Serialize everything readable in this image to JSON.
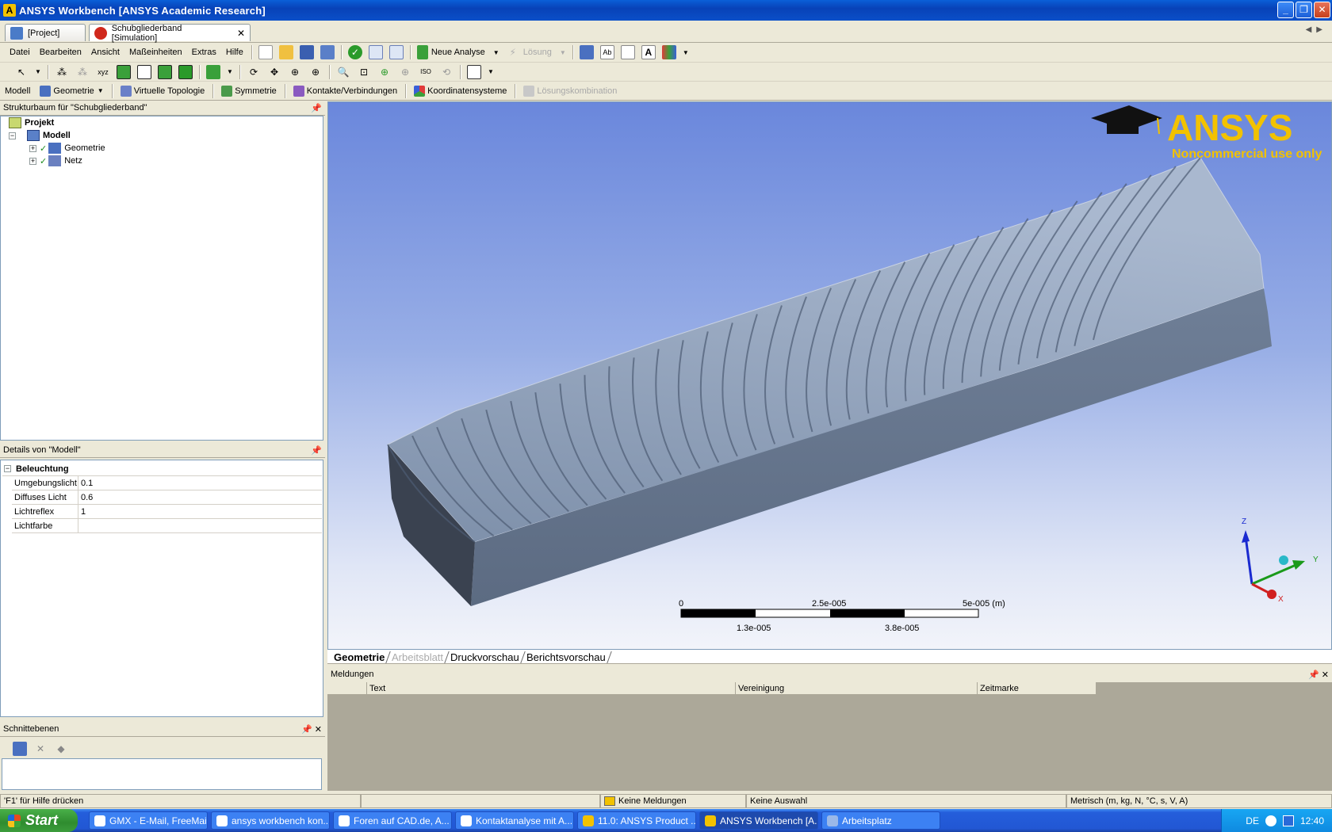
{
  "window": {
    "title": "ANSYS Workbench [ANSYS Academic Research]",
    "app_icon": "ansys-icon"
  },
  "doc_tabs": [
    {
      "label": "[Project]",
      "icon": "project-icon"
    },
    {
      "label": "Schubgliederband [Simulation]",
      "icon": "simulation-icon",
      "close": "✕"
    }
  ],
  "menu": [
    "Datei",
    "Bearbeiten",
    "Ansicht",
    "Maßeinheiten",
    "Extras",
    "Hilfe"
  ],
  "toolbar": {
    "new_analysis": "Neue Analyse",
    "solve": "Lösung"
  },
  "context_bar": {
    "model": "Modell",
    "geometry": "Geometrie",
    "virtual_topology": "Virtuelle Topologie",
    "symmetry": "Symmetrie",
    "contacts": "Kontakte/Verbindungen",
    "coordinate_systems": "Koordinatensysteme",
    "solution_combination": "Lösungskombination"
  },
  "tree_panel": {
    "title": "Strukturbaum für \"Schubgliederband\"",
    "items": [
      {
        "label": "Projekt",
        "level": 0
      },
      {
        "label": "Modell",
        "level": 1
      },
      {
        "label": "Geometrie",
        "level": 2
      },
      {
        "label": "Netz",
        "level": 2
      }
    ]
  },
  "details_panel": {
    "title": "Details von \"Modell\"",
    "section": "Beleuchtung",
    "rows": [
      {
        "key": "Umgebungslicht",
        "value": "0.1"
      },
      {
        "key": "Diffuses Licht",
        "value": "0.6"
      },
      {
        "key": "Lichtreflex",
        "value": "1"
      },
      {
        "key": "Lichtfarbe",
        "value": ""
      }
    ]
  },
  "cut_panel": {
    "title": "Schnittebenen"
  },
  "viewport": {
    "logo_text": "ANSYS",
    "watermark": "Noncommercial use only",
    "scale": {
      "top_labels": [
        "0",
        "2.5e-005",
        "5e-005 (m)"
      ],
      "bottom_labels": [
        "1.3e-005",
        "3.8e-005"
      ]
    },
    "axes": {
      "z": "Z",
      "y": "Y",
      "x": "X"
    }
  },
  "view_tabs": [
    {
      "label": "Geometrie",
      "state": "active"
    },
    {
      "label": "Arbeitsblatt",
      "state": "disabled"
    },
    {
      "label": "Druckvorschau",
      "state": "normal"
    },
    {
      "label": "Berichtsvorschau",
      "state": "normal"
    }
  ],
  "messages": {
    "title": "Meldungen",
    "columns": [
      "",
      "Text",
      "Vereinigung",
      "Zeitmarke"
    ]
  },
  "statusbar": {
    "help": "'F1' für Hilfe drücken",
    "messages": "Keine Meldungen",
    "selection": "Keine Auswahl",
    "units": "Metrisch (m, kg, N, °C, s, V, A)"
  },
  "taskbar": {
    "start": "Start",
    "tasks": [
      "GMX - E-Mail, FreeMai...",
      "ansys workbench kon...",
      "Foren auf CAD.de, A...",
      "Kontaktanalyse mit A...",
      "11.0: ANSYS Product ...",
      "ANSYS Workbench [A...",
      "Arbeitsplatz"
    ],
    "lang": "DE",
    "clock": "12:40"
  },
  "colors": {
    "viewport_top": "#6a87dc",
    "viewport_bottom": "#f2f4fa",
    "logo_yellow": "#f2c200",
    "model_gray": "#7d8da5"
  }
}
